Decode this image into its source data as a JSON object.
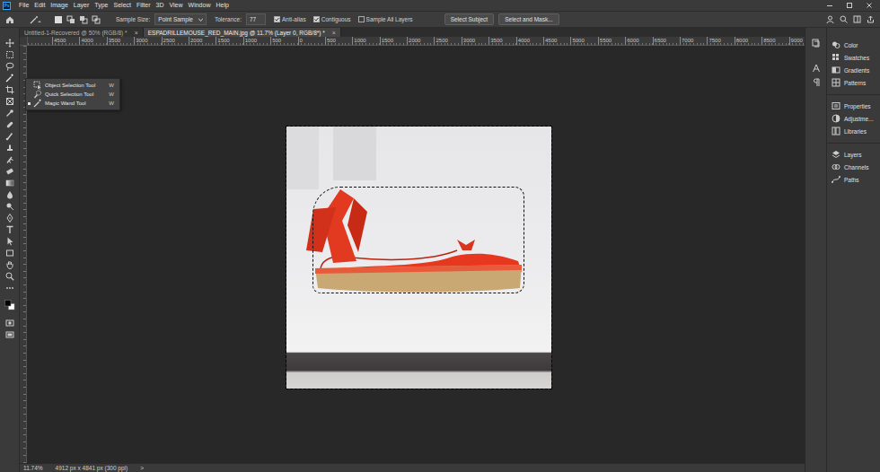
{
  "app": {
    "logo": "Ps"
  },
  "menu": [
    "File",
    "Edit",
    "Image",
    "Layer",
    "Type",
    "Select",
    "Filter",
    "3D",
    "View",
    "Window",
    "Help"
  ],
  "options_bar": {
    "sample_size_label": "Sample Size:",
    "sample_size": "Point Sample",
    "tolerance_label": "Tolerance:",
    "tolerance": "77",
    "checkboxes": [
      {
        "label": "Anti-alias",
        "checked": true
      },
      {
        "label": "Contiguous",
        "checked": true
      },
      {
        "label": "Sample All Layers",
        "checked": false
      }
    ],
    "buttons": [
      "Select Subject",
      "Select and Mask..."
    ]
  },
  "tabs": [
    {
      "label": "Untitled-1-Recovered @ 50% (RGB/8) *",
      "close": "×",
      "selected": false
    },
    {
      "label": "ESPADRILLEMOUSE_RED_MAIN.jpg @ 11.7% (Layer 0, RGB/8*) *",
      "close": "×",
      "selected": true
    }
  ],
  "ruler": {
    "ticks": [
      "4500",
      "4000",
      "3500",
      "3000",
      "2500",
      "2000",
      "1500",
      "1000",
      "500",
      "0",
      "500",
      "1000",
      "1500",
      "2000",
      "2500",
      "3000",
      "3500",
      "4000",
      "4500",
      "5000",
      "5500",
      "6000",
      "6500",
      "7000",
      "7500",
      "8000",
      "8500",
      "9000"
    ]
  },
  "tool_flyout": {
    "items": [
      {
        "label": "Object Selection Tool",
        "shortcut": "W",
        "selected": false
      },
      {
        "label": "Quick Selection Tool",
        "shortcut": "W",
        "selected": false
      },
      {
        "label": "Magic Wand Tool",
        "shortcut": "W",
        "selected": true
      }
    ]
  },
  "panels": [
    [
      "Color",
      "Swatches",
      "Gradients",
      "Patterns"
    ],
    [
      "Properties",
      "Adjustme...",
      "Libraries"
    ],
    [
      "Layers",
      "Channels",
      "Paths"
    ]
  ],
  "status_bar": {
    "zoom": "11.74%",
    "info": "4912 px x 4841 px (300 ppi)",
    "arrow": ">"
  }
}
